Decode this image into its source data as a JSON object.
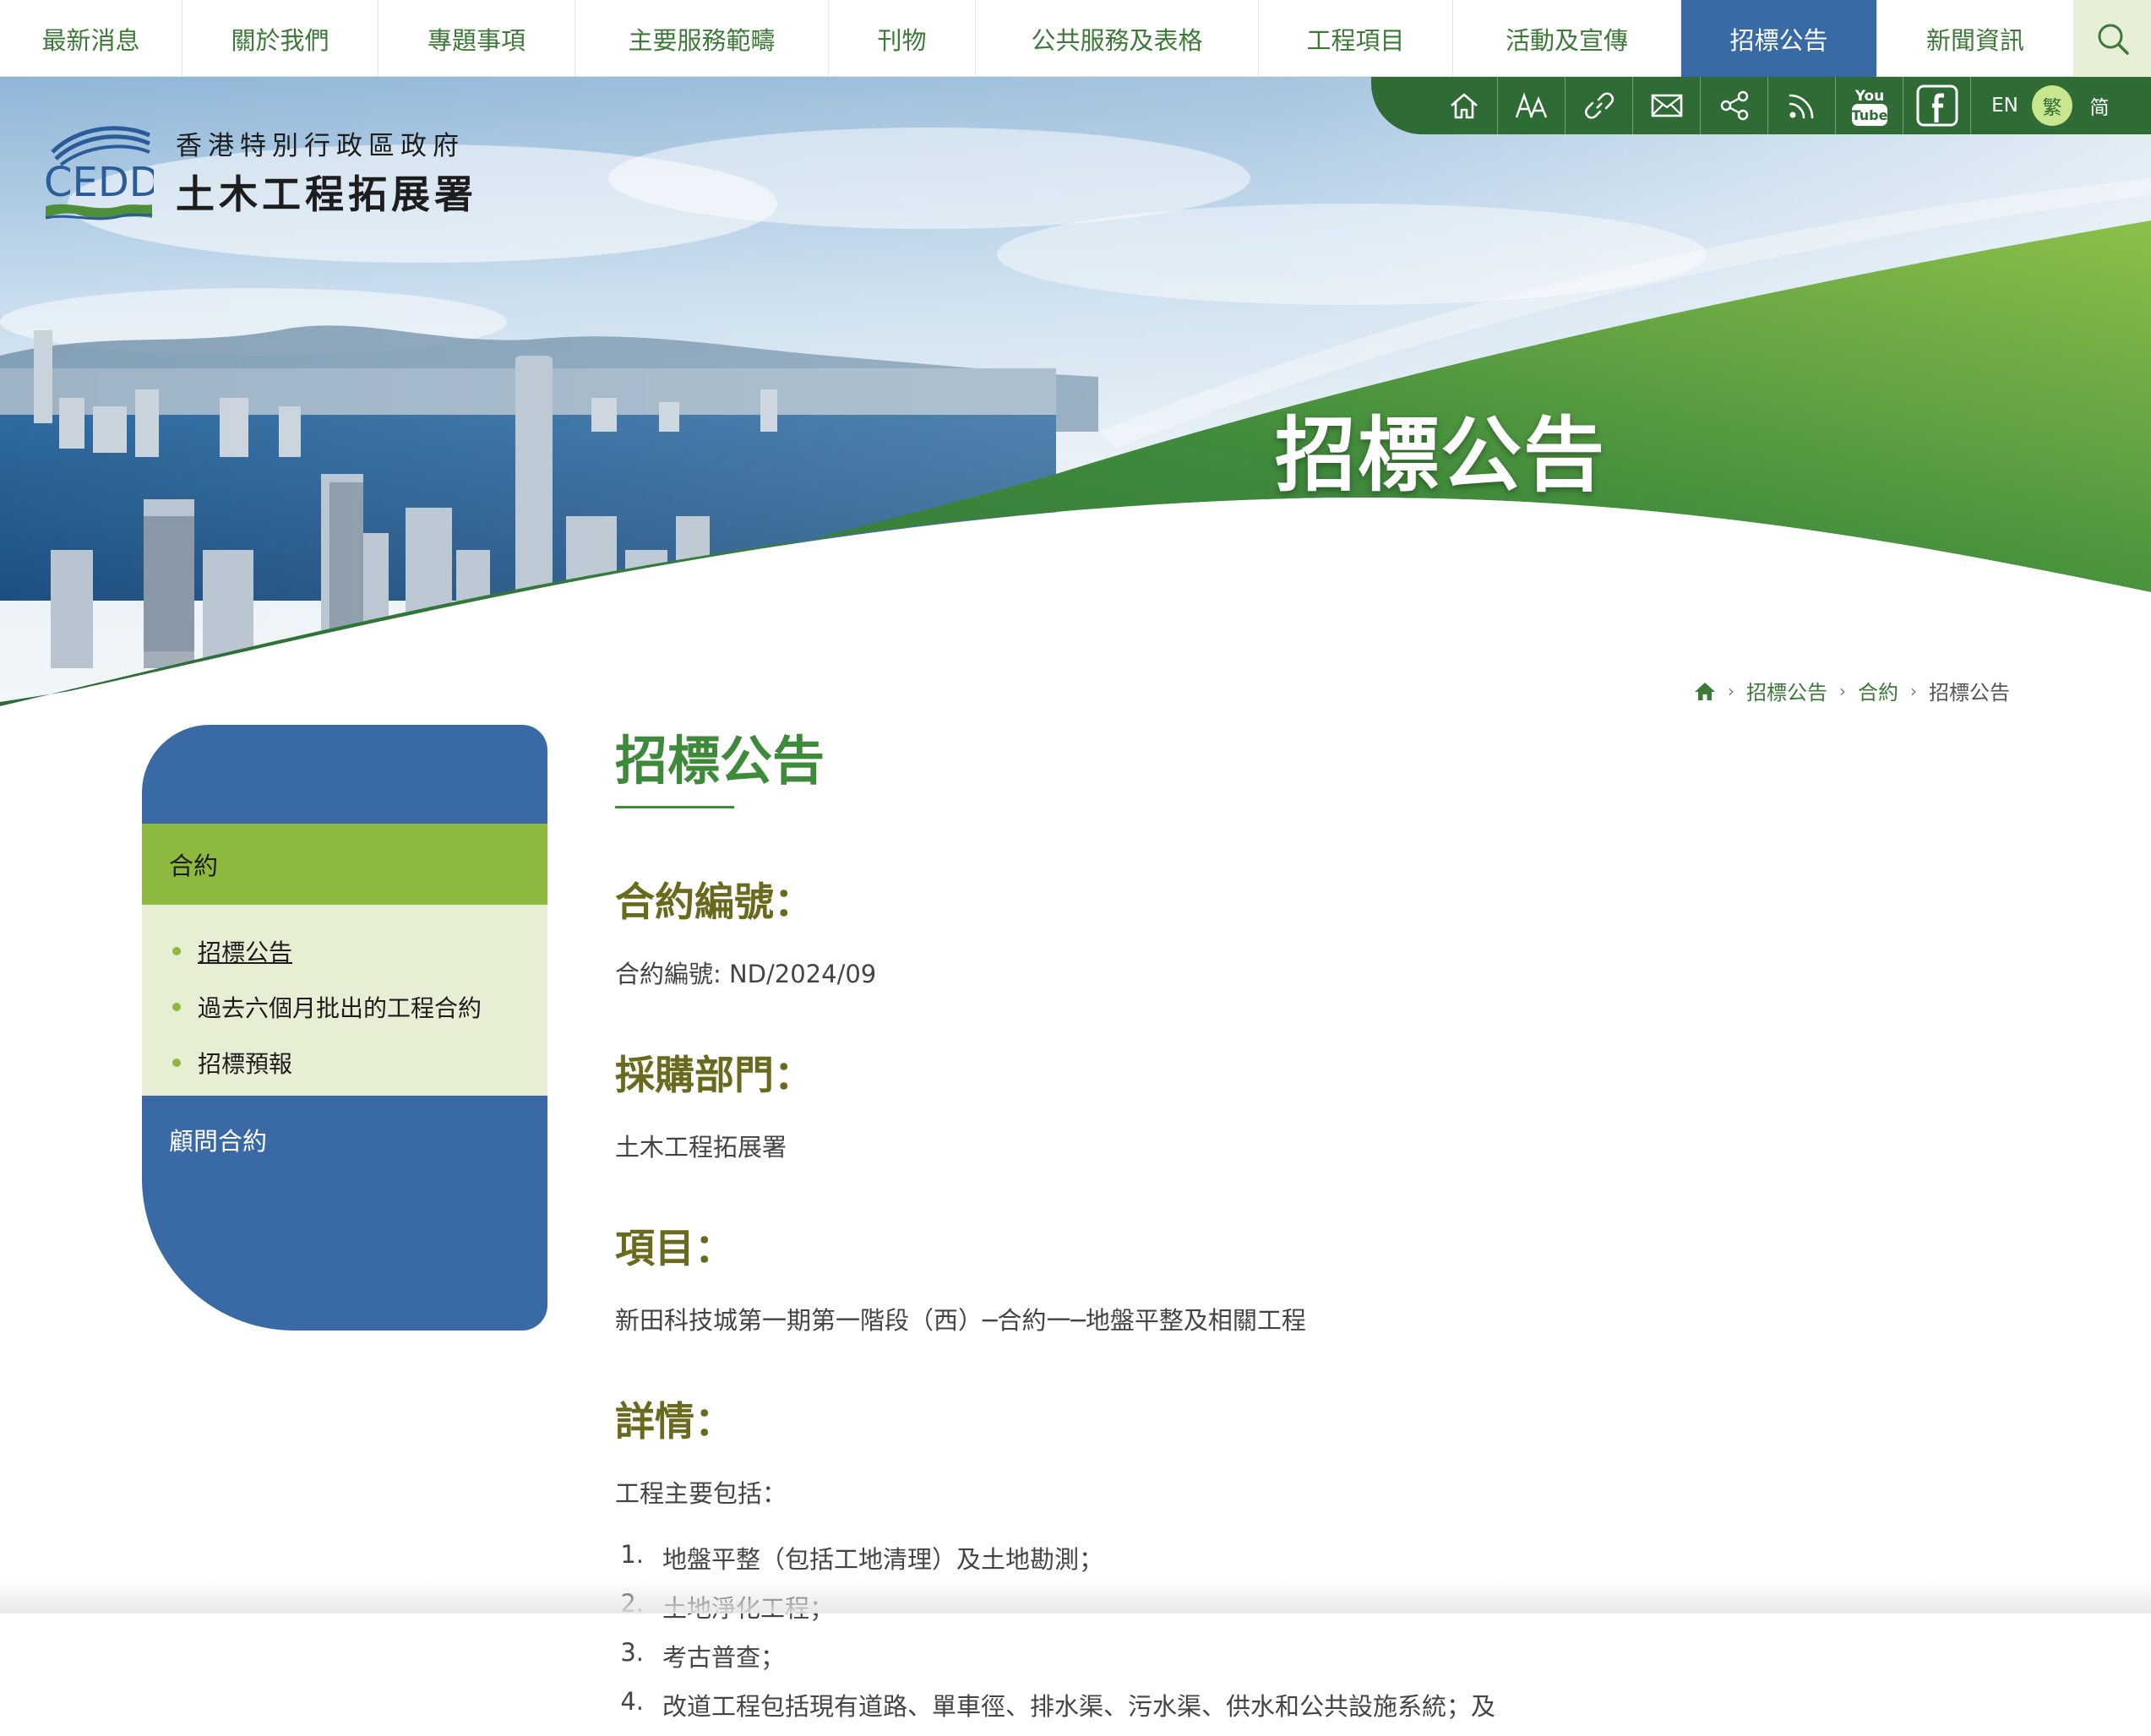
{
  "nav": {
    "items": [
      {
        "label": "最新消息",
        "name": "nav-latest-news"
      },
      {
        "label": "關於我們",
        "name": "nav-about-us"
      },
      {
        "label": "專題事項",
        "name": "nav-special-topics"
      },
      {
        "label": "主要服務範疇",
        "name": "nav-major-services"
      },
      {
        "label": "刊物",
        "name": "nav-publications"
      },
      {
        "label": "公共服務及表格",
        "name": "nav-public-services-forms"
      },
      {
        "label": "工程項目",
        "name": "nav-projects"
      },
      {
        "label": "活動及宣傳",
        "name": "nav-events-publicity"
      },
      {
        "label": "招標公告",
        "name": "nav-tender-notices"
      },
      {
        "label": "新聞資訊",
        "name": "nav-press-releases"
      }
    ],
    "active_index": 8
  },
  "logo": {
    "abbr": "CEDD",
    "line1": "香港特別行政區政府",
    "line2": "土木工程拓展署"
  },
  "utility": {
    "icons": [
      "home-icon",
      "font-size-icon",
      "link-icon",
      "mail-icon",
      "share-icon",
      "rss-icon",
      "youtube-icon",
      "facebook-icon"
    ],
    "youtube_label_top": "You",
    "youtube_label_bottom": "Tube",
    "languages": [
      "EN",
      "繁",
      "简"
    ],
    "active_language": "繁"
  },
  "banner": {
    "title": "招標公告"
  },
  "breadcrumb": {
    "items": [
      "招標公告",
      "合約"
    ],
    "current": "招標公告"
  },
  "sidebar": {
    "section": "合約",
    "sub_items": [
      "招標公告",
      "過去六個月批出的工程合約",
      "招標預報"
    ],
    "other": "顧問合約"
  },
  "main": {
    "title": "招標公告",
    "sections": [
      {
        "heading": "合約編號：",
        "body": "合約編號: ND/2024/09"
      },
      {
        "heading": "採購部門：",
        "body": "土木工程拓展署"
      },
      {
        "heading": "項目：",
        "body": "新田科技城第一期第一階段（西）─合約一─地盤平整及相關工程"
      },
      {
        "heading": "詳情：",
        "body": "工程主要包括："
      }
    ],
    "list": [
      "地盤平整（包括工地清理）及土地勘測；",
      "土地淨化工程；",
      "考古普查；",
      "改道工程包括現有道路、單車徑、排水渠、污水渠、供水和公共設施系統；及"
    ]
  },
  "colors": {
    "nav_active": "#3a6aa5",
    "brand_green": "#3d8a3a",
    "heading_olive": "#6a6a1e",
    "sidebar_blue": "#3a6aa5",
    "sidebar_green": "#8db93e",
    "sidebar_light": "#e6efd3"
  }
}
